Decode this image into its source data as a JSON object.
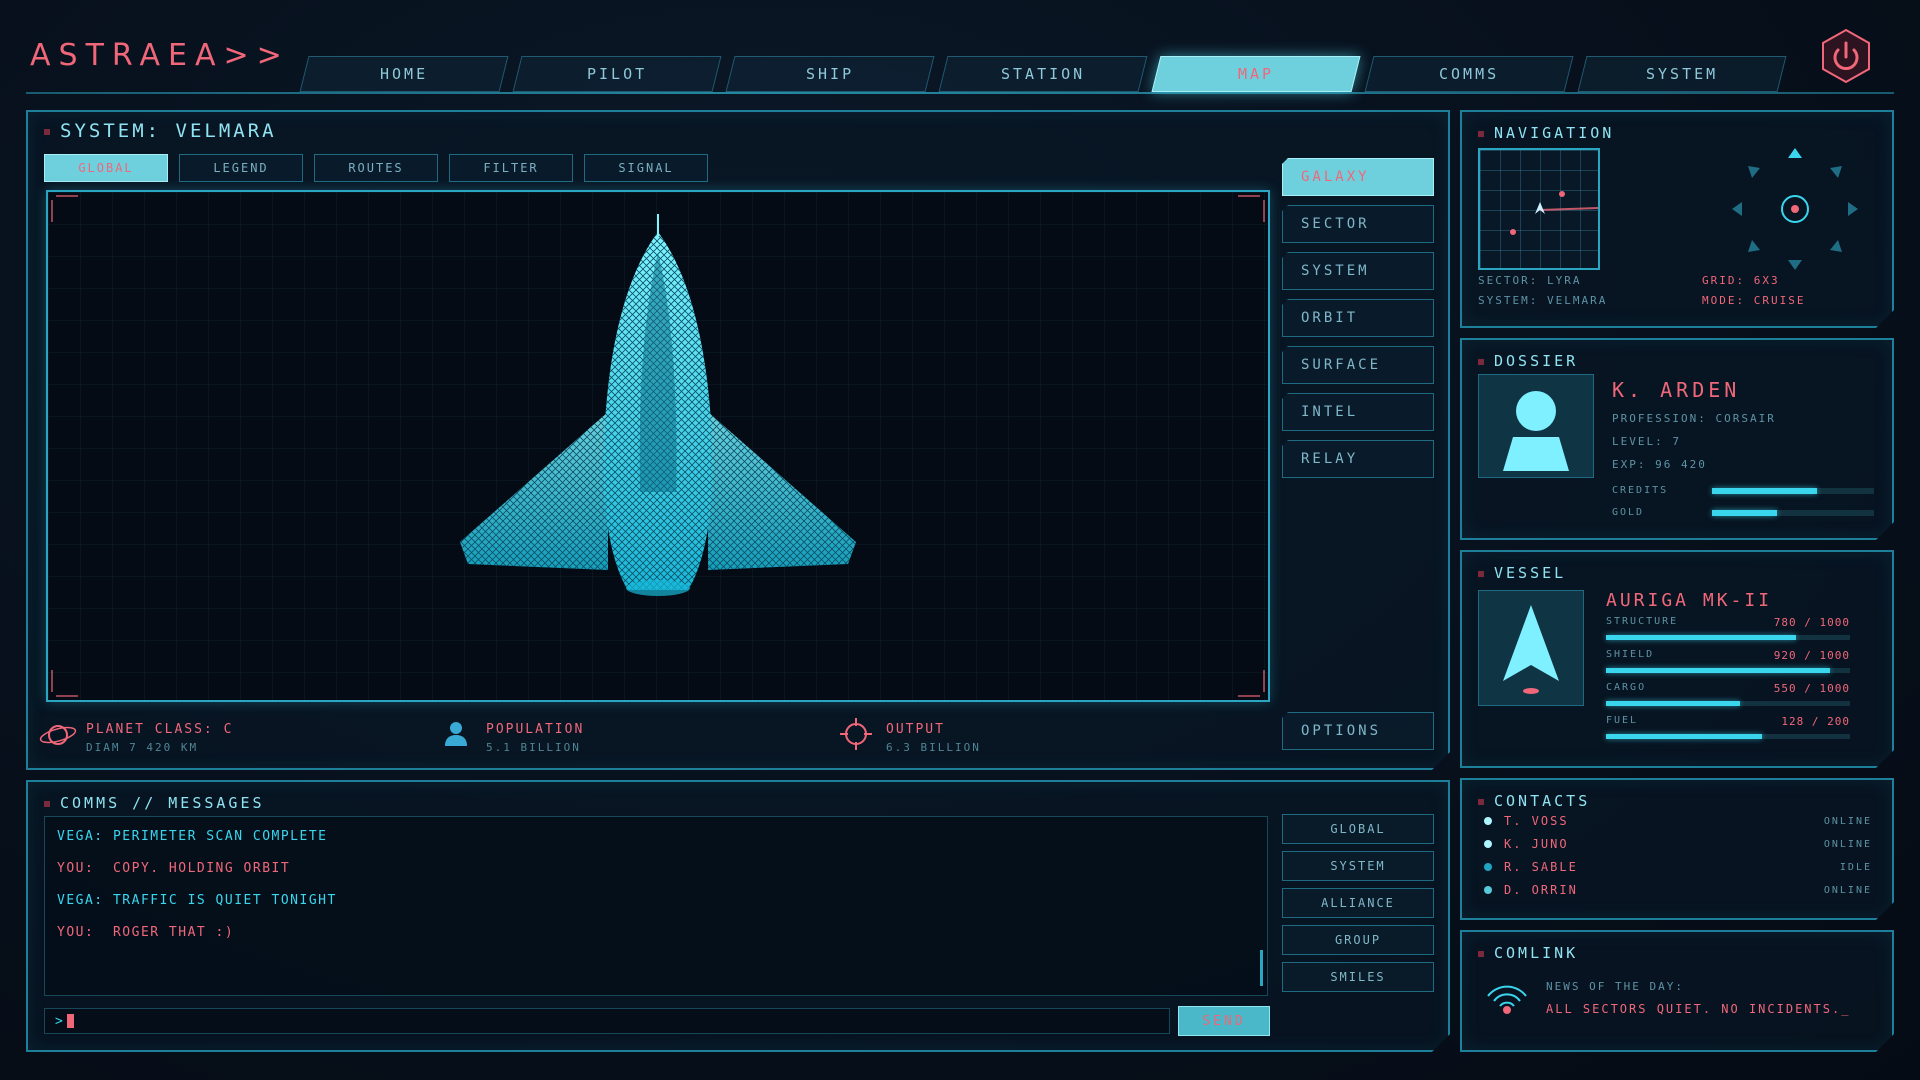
{
  "header": {
    "logo": "ASTRAEA>>",
    "tabs": [
      "HOME",
      "PILOT",
      "SHIP",
      "STATION",
      "MAP",
      "COMMS",
      "SYSTEM"
    ],
    "active_tab": "MAP"
  },
  "map_panel": {
    "title": "SYSTEM: VELMARA",
    "subtabs": [
      "GLOBAL",
      "LEGEND",
      "ROUTES",
      "FILTER",
      "SIGNAL"
    ],
    "side_buttons": [
      "GALAXY",
      "SECTOR",
      "SYSTEM",
      "ORBIT",
      "SURFACE",
      "INTEL",
      "RELAY"
    ],
    "options_label": "OPTIONS",
    "stats": {
      "planet_label": "PLANET CLASS: C",
      "planet_sub": "DIAM 7 420 KM",
      "population_label": "POPULATION",
      "population_sub": "5.1 BILLION",
      "output_label": "OUTPUT",
      "output_sub": "6.3 BILLION"
    }
  },
  "comms": {
    "title": "COMMS // MESSAGES",
    "messages": [
      {
        "speaker": "VEGA:",
        "text": "PERIMETER SCAN COMPLETE"
      },
      {
        "speaker": "YOU:",
        "text": "COPY. HOLDING ORBIT"
      },
      {
        "speaker": "VEGA:",
        "text": "TRAFFIC IS QUIET TONIGHT"
      },
      {
        "speaker": "YOU:",
        "text": "ROGER THAT :)"
      }
    ],
    "prompt": ">",
    "send_label": "SEND",
    "channels": [
      "GLOBAL",
      "SYSTEM",
      "ALLIANCE",
      "GROUP",
      "SMILES"
    ]
  },
  "navigation": {
    "title": "NAVIGATION",
    "sector": "SECTOR: LYRA",
    "system": "SYSTEM: VELMARA",
    "grid": "GRID: 6X3",
    "mode": "MODE: CRUISE"
  },
  "dossier": {
    "title": "DOSSIER",
    "name": "K. ARDEN",
    "profession": "PROFESSION: CORSAIR",
    "level": "LEVEL: 7",
    "exp": "EXP: 96 420",
    "credits_label": "CREDITS",
    "credits_fill": 0.65,
    "gold_label": "GOLD",
    "gold_fill": 0.4
  },
  "vessel": {
    "title": "VESSEL",
    "name": "AURIGA MK-II",
    "stats": [
      {
        "label": "STRUCTURE",
        "value": "780 / 1000",
        "fill": 0.78
      },
      {
        "label": "SHIELD",
        "value": "920 / 1000",
        "fill": 0.92
      },
      {
        "label": "CARGO",
        "value": "550 / 1000",
        "fill": 0.55
      },
      {
        "label": "FUEL",
        "value": "128 / 200",
        "fill": 0.64
      }
    ]
  },
  "contacts": {
    "title": "CONTACTS",
    "list": [
      {
        "name": "T. VOSS",
        "status": "ONLINE"
      },
      {
        "name": "K. JUNO",
        "status": "ONLINE"
      },
      {
        "name": "R. SABLE",
        "status": "IDLE"
      },
      {
        "name": "D. ORRIN",
        "status": "ONLINE"
      }
    ]
  },
  "comlink": {
    "title": "COMLINK",
    "label": "NEWS OF THE DAY:",
    "message": "ALL SECTORS QUIET. NO INCIDENTS._"
  },
  "colors": {
    "accent": "#39d6ee",
    "alert": "#f0677a",
    "panel_border": "#1e7f9a"
  }
}
